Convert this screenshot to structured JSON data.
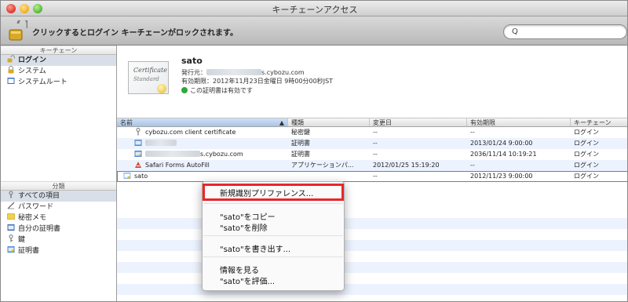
{
  "window": {
    "title": "キーチェーンアクセス"
  },
  "toolbar": {
    "lock_message": "クリックするとログイン キーチェーンがロックされます。",
    "search_icon": "Q",
    "search_value": ""
  },
  "sidebar": {
    "keychains_header": "キーチェーン",
    "keychains": [
      {
        "label": "ログイン",
        "icon": "lock-open-icon",
        "selected": true
      },
      {
        "label": "システム",
        "icon": "lock-icon",
        "selected": false
      },
      {
        "label": "システムルート",
        "icon": "folder-icon",
        "selected": false
      }
    ],
    "category_header": "分類",
    "categories": [
      {
        "label": "すべての項目",
        "icon": "all-items-icon",
        "selected": true
      },
      {
        "label": "パスワード",
        "icon": "password-icon",
        "selected": false
      },
      {
        "label": "秘密メモ",
        "icon": "secure-note-icon",
        "selected": false
      },
      {
        "label": "自分の証明書",
        "icon": "my-certificate-icon",
        "selected": false
      },
      {
        "label": "鍵",
        "icon": "key-icon",
        "selected": false
      },
      {
        "label": "証明書",
        "icon": "certificate-icon",
        "selected": false
      }
    ]
  },
  "detail": {
    "cert_image_line1": "Certificate",
    "cert_image_line2": "Standard",
    "name": "sato",
    "issuer_label": "発行元：",
    "issuer_value": "s.cybozu.com",
    "expiry": "有効期限：2012年11月23日金曜日 9時00分00秒JST",
    "valid_text": "この証明書は有効です"
  },
  "table": {
    "columns": [
      "名前",
      "種類",
      "変更日",
      "有効期限",
      "キーチェーン"
    ],
    "sort_indicator": "▲",
    "rows": [
      {
        "name": "cybozu.com client certificate",
        "icon": "key-row-icon",
        "type": "秘密鍵",
        "modified": "--",
        "expires": "--",
        "keychain": "ログイン"
      },
      {
        "name": "",
        "icon": "cert-row-icon",
        "type": "証明書",
        "modified": "--",
        "expires": "2013/01/24 9:00:00",
        "keychain": "ログイン"
      },
      {
        "name": "s.cybozu.com",
        "icon": "cert-row-icon",
        "type": "証明書",
        "modified": "--",
        "expires": "2036/11/14 10:19:21",
        "keychain": "ログイン"
      },
      {
        "name": "Safari Forms AutoFill",
        "icon": "app-password-icon",
        "type": "アプリケーションパ...",
        "modified": "2012/01/25 15:19:20",
        "expires": "--",
        "keychain": "ログイン"
      },
      {
        "name": "sato",
        "icon": "cert-row-icon",
        "type": "",
        "modified": "--",
        "expires": "2012/11/23 9:00:00",
        "keychain": "ログイン"
      }
    ]
  },
  "context_menu": {
    "items": [
      "新規識別プリファレンス...",
      "\"sato\"をコピー",
      "\"sato\"を削除",
      "\"sato\"を書き出す...",
      "情報を見る",
      "\"sato\"を評価..."
    ]
  },
  "colors": {
    "highlight": "#e8262b",
    "selection": "#d9dfe8",
    "valid": "#2ea83a"
  }
}
